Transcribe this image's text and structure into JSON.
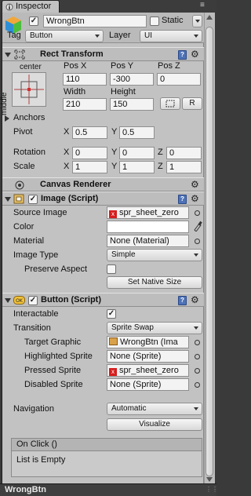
{
  "window": {
    "tab_title": "Inspector",
    "menu_glyph": "≡"
  },
  "gameobject": {
    "name": "WrongBtn",
    "active": true,
    "static_label": "Static",
    "static_checked": false,
    "tag_label": "Tag",
    "tag_value": "Button",
    "layer_label": "Layer",
    "layer_value": "UI"
  },
  "rect_transform": {
    "title": "Rect Transform",
    "anchor_preset_h": "center",
    "anchor_preset_v": "middle",
    "pos_x_label": "Pos X",
    "pos_y_label": "Pos Y",
    "pos_z_label": "Pos Z",
    "pos_x": "110",
    "pos_y": "-300",
    "pos_z": "0",
    "width_label": "Width",
    "height_label": "Height",
    "width": "210",
    "height": "150",
    "raw_button": "R",
    "anchors_label": "Anchors",
    "pivot_label": "Pivot",
    "pivot_x": "0.5",
    "pivot_y": "0.5",
    "rotation_label": "Rotation",
    "rot_x": "0",
    "rot_y": "0",
    "rot_z": "0",
    "scale_label": "Scale",
    "scale_x": "1",
    "scale_y": "1",
    "scale_z": "1",
    "x": "X",
    "y": "Y",
    "z": "Z"
  },
  "canvas_renderer": {
    "title": "Canvas Renderer"
  },
  "image": {
    "title": "Image (Script)",
    "enabled": true,
    "source_image_label": "Source Image",
    "source_image_value": "spr_sheet_zero",
    "color_label": "Color",
    "material_label": "Material",
    "material_value": "None (Material)",
    "image_type_label": "Image Type",
    "image_type_value": "Simple",
    "preserve_aspect_label": "Preserve Aspect",
    "preserve_aspect": false,
    "set_native_size": "Set Native Size"
  },
  "button": {
    "title": "Button (Script)",
    "enabled": true,
    "interactable_label": "Interactable",
    "interactable": true,
    "transition_label": "Transition",
    "transition_value": "Sprite Swap",
    "target_graphic_label": "Target Graphic",
    "target_graphic_value": "WrongBtn (Ima",
    "highlighted_sprite_label": "Highlighted Sprite",
    "highlighted_sprite_value": "None (Sprite)",
    "pressed_sprite_label": "Pressed Sprite",
    "pressed_sprite_value": "spr_sheet_zero",
    "disabled_sprite_label": "Disabled Sprite",
    "disabled_sprite_value": "None (Sprite)",
    "navigation_label": "Navigation",
    "navigation_value": "Automatic",
    "visualize": "Visualize",
    "onclick_label": "On Click ()",
    "onclick_list": "List is Empty"
  },
  "footer": {
    "object_name": "WrongBtn"
  },
  "colors": {
    "panel": "#c2c2c2",
    "header": "#bdbdbd",
    "dark": "#3a3a3a",
    "book": "#4d72b8",
    "missing": "#d61d1d"
  }
}
